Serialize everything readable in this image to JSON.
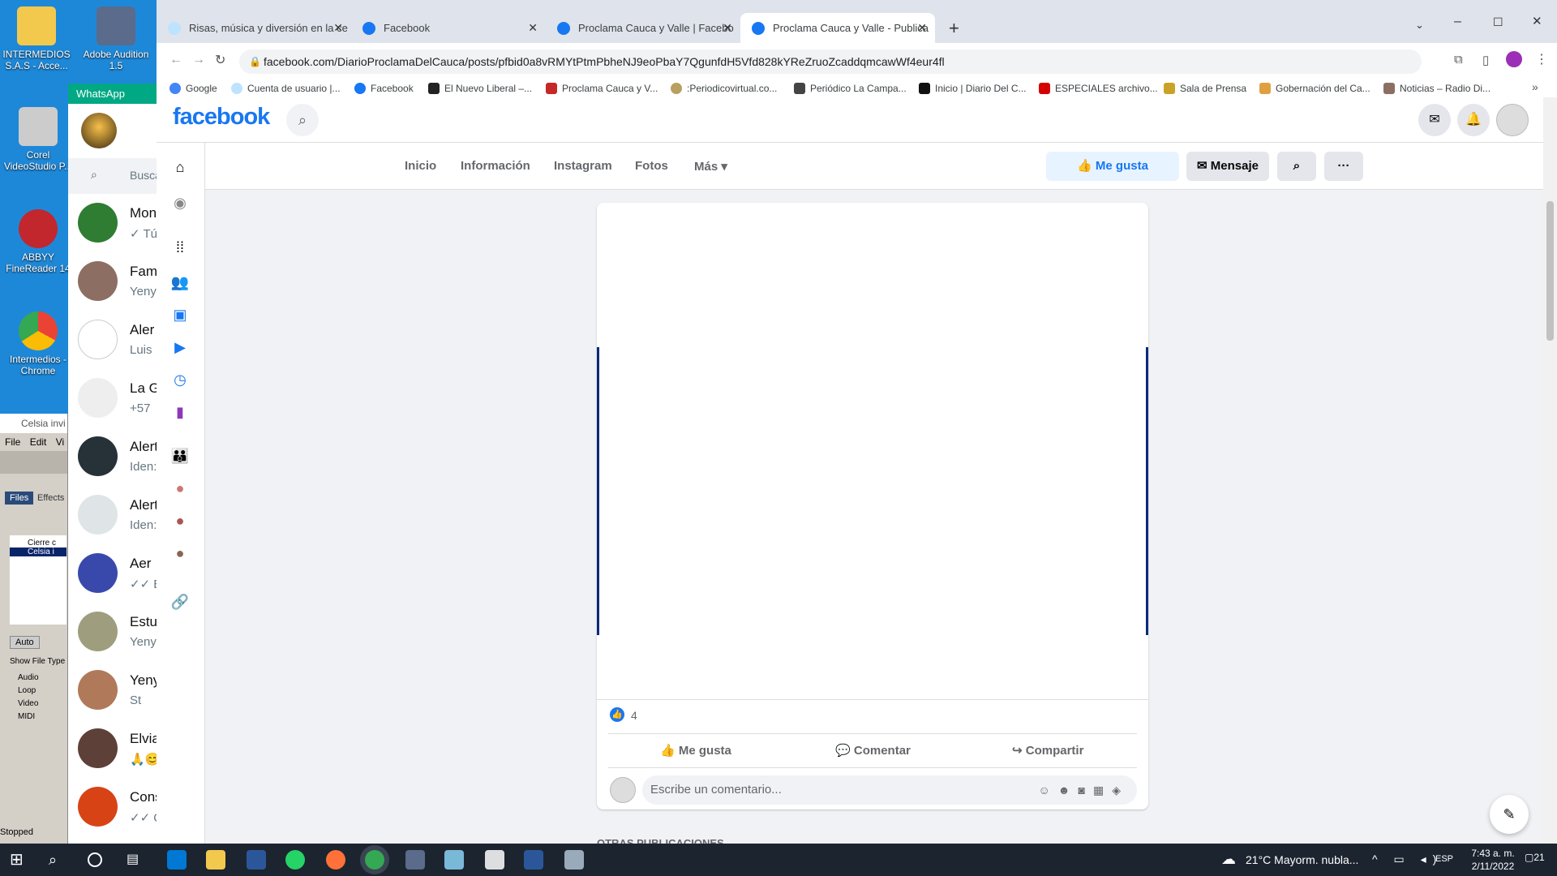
{
  "desktop": {
    "icons": [
      {
        "label": "INTERMEDIOS S.A.S - Acce...",
        "color": "#f2c94c"
      },
      {
        "label": "Adobe Audition 1.5",
        "color": "#5a6b8c"
      },
      {
        "label": "Corel VideoStudio P...",
        "color": "#ddd"
      },
      {
        "label": "ABBYY FineReader 14",
        "color": "#c1272d"
      },
      {
        "label": "Intermedios - Chrome",
        "color": "#34a853"
      }
    ]
  },
  "whatsapp": {
    "title": "WhatsApp",
    "search": "Busca",
    "chats": [
      {
        "name": "Mon",
        "preview": "✓ Tú",
        "color": "#2e7d32"
      },
      {
        "name": "Fam",
        "preview": "Yeny",
        "color": "#8d6e63"
      },
      {
        "name": "Aler",
        "preview": "Luis",
        "color": "#1b5e20"
      },
      {
        "name": "La G",
        "preview": "+57",
        "color": "#eee"
      },
      {
        "name": "Alert",
        "preview": "Iden:",
        "color": "#263238"
      },
      {
        "name": "Alert",
        "preview": "Iden:",
        "color": "#dfe5e7"
      },
      {
        "name": "Aer",
        "preview": "✓✓ Bi",
        "color": "#3949ab"
      },
      {
        "name": "Estu",
        "preview": "Yeny",
        "color": "#9e9e7e"
      },
      {
        "name": "Yeny",
        "preview": "St",
        "color": "#b07a5a"
      },
      {
        "name": "Elvia",
        "preview": "🙏😊",
        "color": "#5d4037"
      },
      {
        "name": "Cons",
        "preview": "✓✓ Q",
        "color": "#d84315"
      }
    ]
  },
  "celsia": {
    "title": "Celsia invi",
    "menu": [
      "File",
      "Edit",
      "Vi"
    ],
    "tabs": [
      "Files",
      "Effects"
    ],
    "files": [
      "Cierre c",
      "Celsia i"
    ],
    "auto": "Auto",
    "show": "Show File Type",
    "types": [
      "Audio",
      "Loop",
      "Video",
      "MIDI"
    ],
    "status": "Stopped"
  },
  "browser": {
    "tabs": [
      {
        "title": "Risas, música y diversión en la ce"
      },
      {
        "title": "Facebook"
      },
      {
        "title": "Proclama Cauca y Valle | Facebo"
      },
      {
        "title": "Proclama Cauca y Valle - Publica"
      }
    ],
    "url": "facebook.com/DiarioProclamaDelCauca/posts/pfbid0a8vRMYtPtmPbheNJ9eoPbaY7QgunfdH5Vfd828kYReZruoZcaddqmcawWf4eur4fl",
    "bookmarks": [
      "Google",
      "Cuenta de usuario |...",
      "Facebook",
      "El Nuevo Liberal –...",
      "Proclama Cauca y V...",
      ":Periodicovirtual.co...",
      "Periódico La Campa...",
      "Inicio | Diario Del C...",
      "ESPECIALES archivo...",
      "Sala de Prensa",
      "Gobernación del Ca...",
      "Noticias – Radio Di..."
    ]
  },
  "facebook": {
    "logo": "facebook",
    "pagenav": [
      "Inicio",
      "Información",
      "Instagram",
      "Fotos",
      "Más"
    ],
    "like_btn": "Me gusta",
    "msg_btn": "Mensaje",
    "reactions": "4",
    "actions": [
      "Me gusta",
      "Comentar",
      "Compartir"
    ],
    "comment_placeholder": "Escribe un comentario...",
    "more_posts": "OTRAS PUBLICACIONES"
  },
  "taskbar": {
    "weather": "21°C  Mayorm. nubla...",
    "lang": "ESP",
    "time": "7:43 a. m.",
    "date": "2/11/2022",
    "notif": "21"
  }
}
